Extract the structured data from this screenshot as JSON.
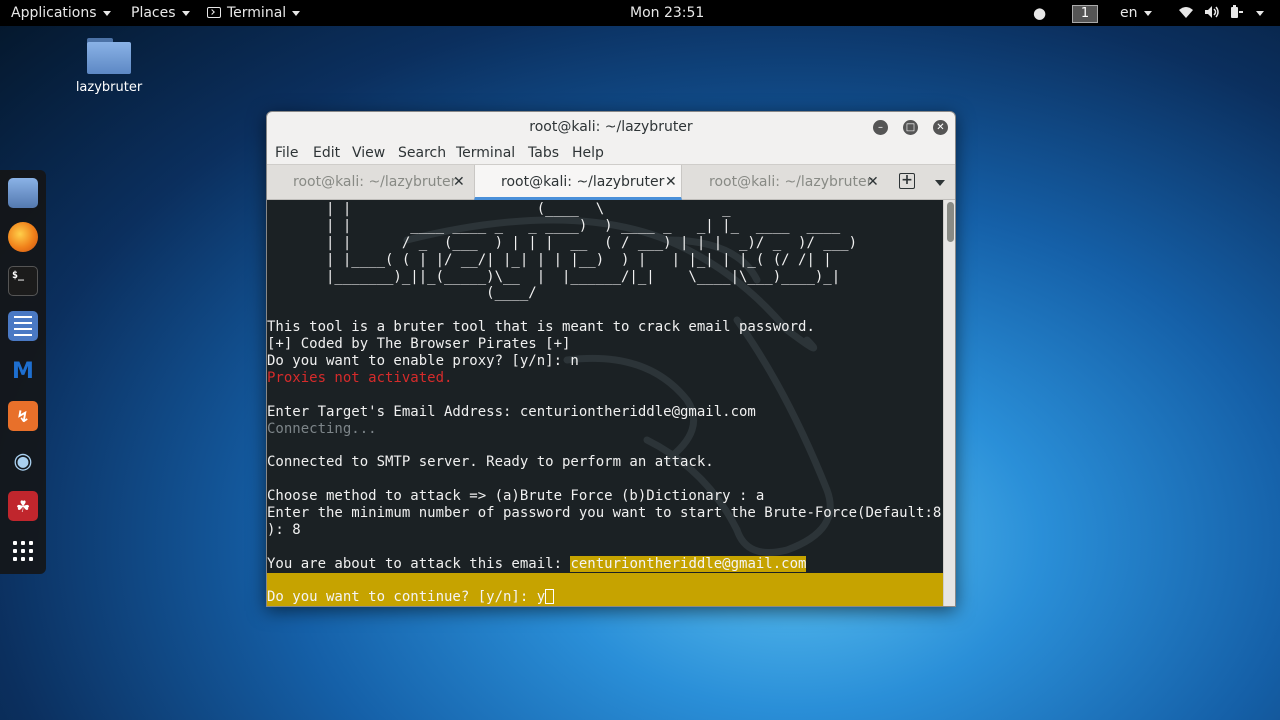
{
  "topbar": {
    "applications": "Applications",
    "places": "Places",
    "terminal": "Terminal",
    "clock": "Mon 23:51",
    "workspace": "1",
    "language": "en"
  },
  "desktop": {
    "icon_label": "lazybruter"
  },
  "window": {
    "title": "root@kali: ~/lazybruter",
    "menu": [
      "File",
      "Edit",
      "View",
      "Search",
      "Terminal",
      "Tabs",
      "Help"
    ],
    "tabs": [
      {
        "label": "root@kali: ~/lazybruter"
      },
      {
        "label": "root@kali: ~/lazybruter"
      },
      {
        "label": "root@kali: ~/lazybruter"
      }
    ],
    "active_tab": 1
  },
  "terminal": {
    "ascii": [
      "       | |                      (____  \\              _",
      "       | |       ____ ____ _   _ ____)  ) ____ _   _| |_  ____  ____",
      "       | |      / _  (___  ) | | |  __  ( / ___) | | |  _)/ _  )/ ___)",
      "       | |____( ( | |/ __/| |_| | | |__)  ) |   | |_| | |_( (/ /| |",
      "       |_______)_||_(_____)\\__  |  |______/|_|    \\____|\\___)____)_|",
      "                          (____/"
    ],
    "intro": "This tool is a bruter tool that is meant to crack email password.",
    "credit": "[+] Coded by The Browser Pirates [+]",
    "proxy_prompt": "Do you want to enable proxy? [y/n]: n",
    "proxy_status": "Proxies not activated.",
    "target_prompt": "Enter Target's Email Address: centuriontheriddle@gmail.com",
    "connecting": "Connecting...",
    "connected": "Connected to SMTP server. Ready to perform an attack.",
    "method_prompt": "Choose method to attack => (a)Brute Force (b)Dictionary : a",
    "min_prompt_1": "Enter the minimum number of password you want to start the Brute-Force(Default:8",
    "min_prompt_2": "): 8",
    "about_prefix": "You are about to attack this email: ",
    "about_email": "centuriontheriddle@gmail.com",
    "continue_prompt": "Do you want to continue? [y/n]: y"
  },
  "colors": {
    "highlight": "#c6a300",
    "error": "#d62b2b",
    "accent": "#4a90d9"
  }
}
